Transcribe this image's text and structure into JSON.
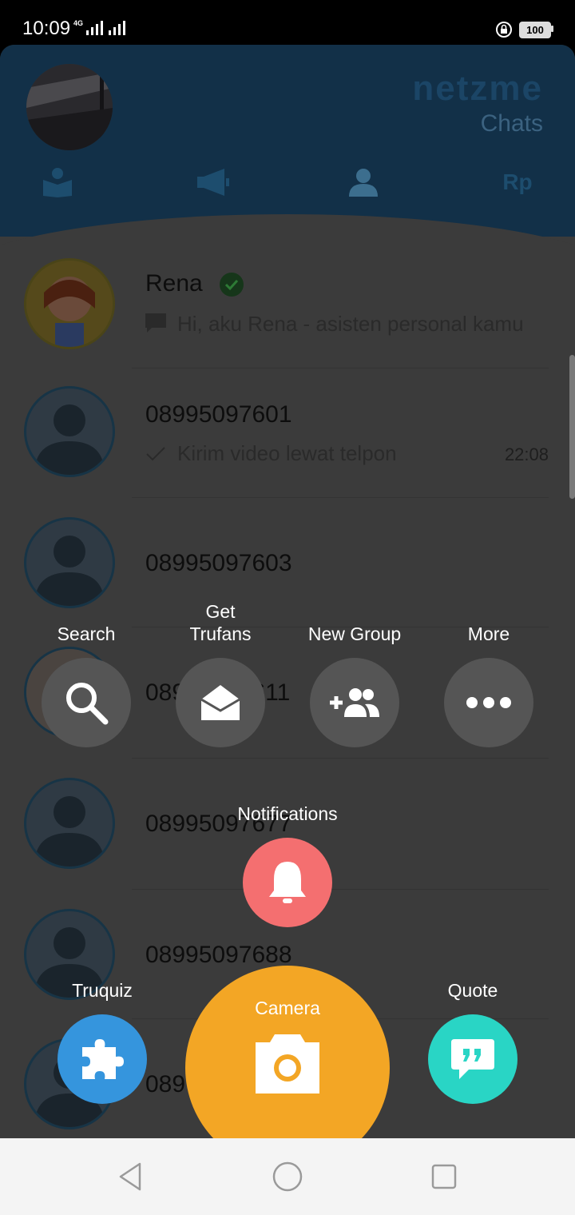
{
  "status_bar": {
    "time": "10:09",
    "network": "4G",
    "battery": "100"
  },
  "header": {
    "brand": "netzme",
    "title": "Chats",
    "rp_tab": "Rp"
  },
  "chats": [
    {
      "name": "Rena",
      "message": "Hi, aku Rena - asisten personal kamu",
      "time": ""
    },
    {
      "name": "08995097601",
      "message": "Kirim video lewat telpon",
      "time": "22:08"
    },
    {
      "name": "08995097603",
      "message": "",
      "time": ""
    },
    {
      "name": "08995097611",
      "message": "",
      "time": ""
    },
    {
      "name": "08995097677",
      "message": "",
      "time": ""
    },
    {
      "name": "08995097688",
      "message": "",
      "time": ""
    },
    {
      "name": "089",
      "message": "",
      "time": ""
    }
  ],
  "fab_menu": {
    "search": "Search",
    "trufans": "Get\nTrufans",
    "new_group": "New Group",
    "more": "More",
    "notifications": "Notifications",
    "truquiz": "Truquiz",
    "camera": "Camera",
    "quote": "Quote"
  },
  "colors": {
    "camera": "#f3a625",
    "notifications": "#f46f70",
    "truquiz": "#3595dd",
    "quote": "#29d5c5",
    "menu_grey": "#555555"
  },
  "icons": {
    "search": "search-icon",
    "trufans": "envelope-open-icon",
    "new_group": "add-group-icon",
    "more": "more-dots-icon",
    "notifications": "bell-icon",
    "truquiz": "puzzle-icon",
    "camera": "camera-icon",
    "quote": "quote-bubble-icon"
  }
}
